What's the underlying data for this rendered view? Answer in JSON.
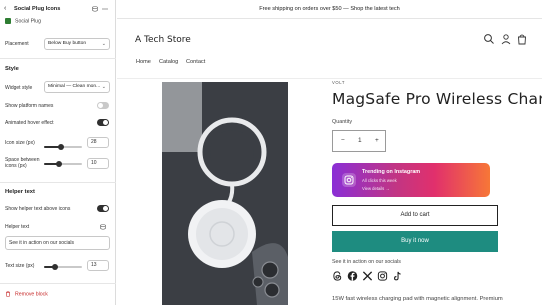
{
  "editor": {
    "title": "Social Plug Icons",
    "app_name": "Social Plug",
    "placement": {
      "label": "Placement",
      "value": "Below Buy button"
    },
    "style_section": "Style",
    "widget_style": {
      "label": "Widget style",
      "value": "Minimal — Clean mon..."
    },
    "show_platform_names": {
      "label": "Show platform names",
      "on": false
    },
    "animated_hover": {
      "label": "Animated hover effect",
      "on": true
    },
    "icon_size": {
      "label": "Icon size (px)",
      "value": "28",
      "level": 0.45
    },
    "space_between": {
      "label": "Space between icons (px)",
      "value": "10",
      "level": 0.4
    },
    "helper_section": "Helper text",
    "show_helper": {
      "label": "Show helper text above icons",
      "on": true
    },
    "helper_text": {
      "label": "Helper text",
      "value": "See it in action on our socials"
    },
    "text_size": {
      "label": "Text size (px)",
      "value": "13",
      "level": 0.3
    },
    "remove_label": "Remove block"
  },
  "store": {
    "announcement": "Free shipping on orders over $50 — Shop the latest tech",
    "logo": "A Tech Store",
    "nav": [
      "Home",
      "Catalog",
      "Contact"
    ],
    "vendor": "VOLT",
    "product_title": "MagSafe Pro Wireless Charger",
    "quantity_label": "Quantity",
    "quantity_value": "1",
    "instagram_card": {
      "title": "Trending on Instagram",
      "subtitle": "All clicks this week",
      "link": "View details →"
    },
    "add_to_cart": "Add to cart",
    "buy_now": "Buy it now",
    "helper_text": "See it in action on our socials",
    "social_icons": [
      "threads-icon",
      "facebook-icon",
      "x-icon",
      "instagram-icon",
      "tiktok-icon"
    ],
    "description": "15W fast wireless charging pad with magnetic alignment. Premium"
  },
  "colors": {
    "accent_green": "#1e8c80",
    "toggle_on": "#303030",
    "danger": "#c62828"
  }
}
